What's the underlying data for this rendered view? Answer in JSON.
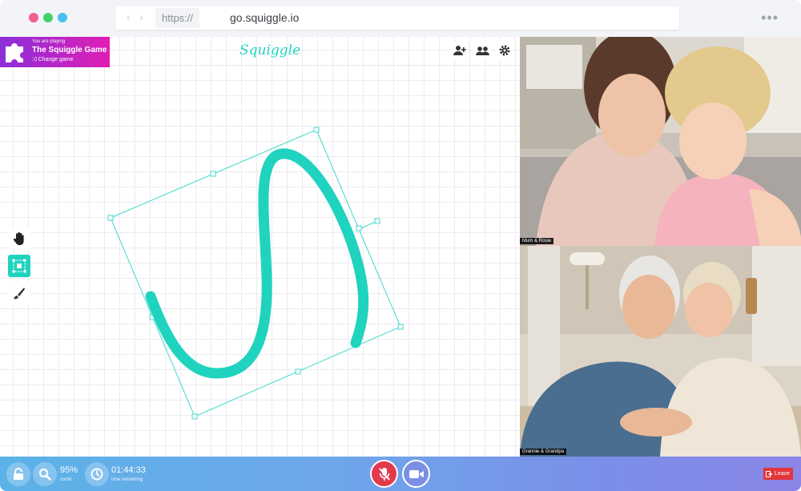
{
  "browser": {
    "scheme": "https://",
    "url": "go.squiggle.io",
    "more_icon": "more-dots-icon",
    "traffic_colors": [
      "#f25f8c",
      "#46d06a",
      "#47c1f2"
    ]
  },
  "game": {
    "pre_label": "You are playing",
    "title": "The Squiggle Game",
    "change_label": "⤨ Change game",
    "gradient": [
      "#8b2fd9",
      "#e01eb4"
    ]
  },
  "app": {
    "logo": "Squiggle",
    "accent_color": "#1fd3bf"
  },
  "top_tools": [
    "add-user-icon",
    "participants-icon",
    "settings-icon"
  ],
  "side_tools": [
    {
      "name": "hand-tool",
      "icon": "hand-icon",
      "active": false
    },
    {
      "name": "select-tool",
      "icon": "select-icon",
      "active": true
    },
    {
      "name": "brush-tool",
      "icon": "brush-icon",
      "active": false
    }
  ],
  "videos": [
    {
      "label": "Mum & Rosie"
    },
    {
      "label": "Grannie & Grandpa"
    }
  ],
  "toolbar": {
    "zoom_value": "95%",
    "zoom_caption": "zoom",
    "time_value": "01:44:33",
    "time_caption": "time remaining",
    "leave_label": "Leave",
    "leave_color": "#e3343b",
    "mic_color": "#e23a4d"
  }
}
